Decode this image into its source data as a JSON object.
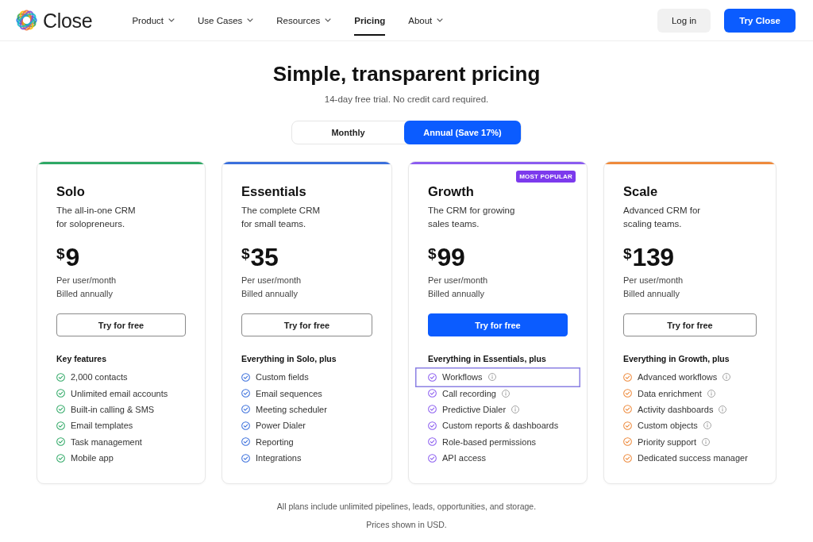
{
  "header": {
    "logo": "Close",
    "nav": [
      {
        "label": "Product",
        "dropdown": true,
        "selected": false
      },
      {
        "label": "Use Cases",
        "dropdown": true,
        "selected": false
      },
      {
        "label": "Resources",
        "dropdown": true,
        "selected": false
      },
      {
        "label": "Pricing",
        "dropdown": false,
        "selected": true
      },
      {
        "label": "About",
        "dropdown": true,
        "selected": false
      }
    ],
    "actions": [
      {
        "label": "Log in",
        "kind": "secondary"
      },
      {
        "label": "Try Close",
        "kind": "primary"
      }
    ]
  },
  "hero": {
    "title": "Simple, transparent pricing",
    "subtitle": "14-day free trial. No credit card required.",
    "billing": [
      {
        "label": "Monthly",
        "selected": false
      },
      {
        "label": "Annual (Save 17%)",
        "selected": true
      }
    ]
  },
  "plans": [
    {
      "name": "Solo",
      "color": "#2ea865",
      "description": "The all-in-one CRM\nfor solopreneurs.",
      "currency": "$",
      "amount": "9",
      "period": "Per user/month",
      "billing_note": "Billed annually",
      "cta": "Try for free",
      "featured": false,
      "features_title": "Key features",
      "features": [
        {
          "text": "2,000 contacts",
          "info": false,
          "focused": false
        },
        {
          "text": "Unlimited email accounts",
          "info": false,
          "focused": false
        },
        {
          "text": "Built-in calling & SMS",
          "info": false,
          "focused": false
        },
        {
          "text": "Email templates",
          "info": false,
          "focused": false
        },
        {
          "text": "Task management",
          "info": false,
          "focused": false
        },
        {
          "text": "Mobile app",
          "info": false,
          "focused": false
        }
      ]
    },
    {
      "name": "Essentials",
      "color": "#3a6fdc",
      "description": "The complete CRM\nfor small teams.",
      "currency": "$",
      "amount": "35",
      "period": "Per user/month",
      "billing_note": "Billed annually",
      "cta": "Try for free",
      "featured": false,
      "features_title": "Everything in Solo, plus",
      "features": [
        {
          "text": "Custom fields",
          "info": false,
          "focused": false
        },
        {
          "text": "Email sequences",
          "info": false,
          "focused": false
        },
        {
          "text": "Meeting scheduler",
          "info": false,
          "focused": false
        },
        {
          "text": "Power Dialer",
          "info": false,
          "focused": false
        },
        {
          "text": "Reporting",
          "info": false,
          "focused": false
        },
        {
          "text": "Integrations",
          "info": false,
          "focused": false
        }
      ]
    },
    {
      "name": "Growth",
      "color": "#8b5cf0",
      "badge": "MOST POPULAR",
      "description": "The CRM for growing\nsales teams.",
      "currency": "$",
      "amount": "99",
      "period": "Per user/month",
      "billing_note": "Billed annually",
      "cta": "Try for free",
      "featured": true,
      "features_title": "Everything in Essentials, plus",
      "features": [
        {
          "text": "Workflows",
          "info": true,
          "focused": true
        },
        {
          "text": "Call recording",
          "info": true,
          "focused": false
        },
        {
          "text": "Predictive Dialer",
          "info": true,
          "focused": false
        },
        {
          "text": "Custom reports & dashboards",
          "info": false,
          "focused": false
        },
        {
          "text": "Role-based permissions",
          "info": false,
          "focused": false
        },
        {
          "text": "API access",
          "info": false,
          "focused": false
        }
      ]
    },
    {
      "name": "Scale",
      "color": "#ee8a3c",
      "description": "Advanced CRM for\nscaling teams.",
      "currency": "$",
      "amount": "139",
      "period": "Per user/month",
      "billing_note": "Billed annually",
      "cta": "Try for free",
      "featured": false,
      "features_title": "Everything in Growth, plus",
      "features": [
        {
          "text": "Advanced workflows",
          "info": true,
          "focused": false
        },
        {
          "text": "Data enrichment",
          "info": true,
          "focused": false
        },
        {
          "text": "Activity dashboards",
          "info": true,
          "focused": false
        },
        {
          "text": "Custom objects",
          "info": true,
          "focused": false
        },
        {
          "text": "Priority support",
          "info": true,
          "focused": false
        },
        {
          "text": "Dedicated success manager",
          "info": false,
          "focused": false
        }
      ]
    }
  ],
  "footer": {
    "notes": [
      "All plans include unlimited pipelines, leads, opportunities, and storage.",
      "Prices shown in USD."
    ]
  }
}
